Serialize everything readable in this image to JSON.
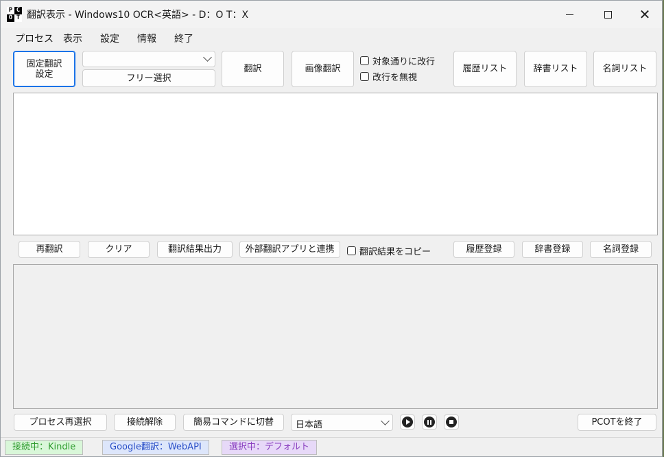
{
  "window": {
    "title": "翻訳表示 - Windows10 OCR<英語> - D：O T：X",
    "icon_letters": [
      "P",
      "C",
      "O",
      "T"
    ]
  },
  "menu": [
    "プロセス",
    "表示",
    "設定",
    "情報",
    "終了"
  ],
  "toolbar": {
    "fixed_translation_setting": "固定翻訳\n設定",
    "combo_value": "",
    "free_select": "フリー選択",
    "translate": "翻訳",
    "image_translate": "画像翻訳",
    "keep_line_breaks": "対象通りに改行",
    "ignore_line_breaks": "改行を無視",
    "history_list": "履歴リスト",
    "dictionary_list": "辞書リスト",
    "noun_list": "名詞リスト"
  },
  "source_text": "",
  "result_text": "",
  "action_bar": {
    "retranslate": "再翻訳",
    "clear": "クリア",
    "output_result": "翻訳結果出力",
    "external_app": "外部翻訳アプリと連携",
    "copy_result": "翻訳結果をコピー",
    "register_history": "履歴登録",
    "register_dictionary": "辞書登録",
    "register_noun": "名詞登録"
  },
  "bottom_bar": {
    "reselect_process": "プロセス再選択",
    "disconnect": "接続解除",
    "switch_simple_command": "簡易コマンドに切替",
    "language": "日本語",
    "quit": "PCOTを終了"
  },
  "status": {
    "connection": "接続中：Kindle",
    "translator": "Google翻訳：WebAPI",
    "selection": "選択中：デフォルト",
    "colors": {
      "connection_bg": "#d9f7d9",
      "connection_fg": "#2e9b2e",
      "translator_bg": "#dde6fb",
      "translator_fg": "#2a4fc7",
      "selection_bg": "#e7d9f8",
      "selection_fg": "#8a3fbf"
    }
  }
}
